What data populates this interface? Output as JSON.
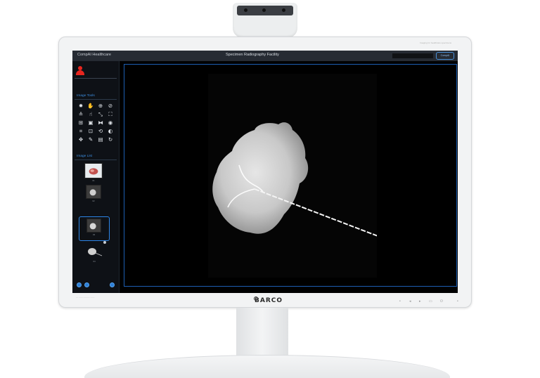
{
  "window": {
    "app_name": "CompAI Healthcare",
    "title": "Specimen Radiography Facility",
    "logo_text": "CompAI"
  },
  "monitor": {
    "brand": "BARCO",
    "top_right_label": "Imaging for healthcare specimens"
  },
  "sidebar": {
    "user_icon": "user-icon",
    "image_tools_title": "Image Tools",
    "image_tools": [
      {
        "name": "brightness-icon",
        "glyph": "✹"
      },
      {
        "name": "pan-hand-icon",
        "glyph": "✋"
      },
      {
        "name": "zoom-in-icon",
        "glyph": "⊕"
      },
      {
        "name": "reset-icon",
        "glyph": "⊘"
      },
      {
        "name": "level-adjust-icon",
        "glyph": "≗"
      },
      {
        "name": "hand-grab-icon",
        "glyph": "☝"
      },
      {
        "name": "measure-line-icon",
        "glyph": "⤡"
      },
      {
        "name": "fit-window-icon",
        "glyph": "⛶"
      },
      {
        "name": "zoom-box-icon",
        "glyph": "⊞"
      },
      {
        "name": "window-level-icon",
        "glyph": "▣"
      },
      {
        "name": "flip-horizontal-icon",
        "glyph": "⧓"
      },
      {
        "name": "eye-icon",
        "glyph": "◉"
      },
      {
        "name": "crop-icon",
        "glyph": "⌗"
      },
      {
        "name": "magnify-region-icon",
        "glyph": "⊡"
      },
      {
        "name": "rotate-icon",
        "glyph": "⟲"
      },
      {
        "name": "invert-icon",
        "glyph": "◐"
      },
      {
        "name": "move-icon",
        "glyph": "✥"
      },
      {
        "name": "annotate-icon",
        "glyph": "✎"
      },
      {
        "name": "save-icon",
        "glyph": "▤"
      },
      {
        "name": "refresh-icon",
        "glyph": "↻"
      }
    ],
    "image_list_title": "Image List",
    "images": [
      {
        "caption": "01"
      },
      {
        "caption": "02"
      },
      {
        "caption": "03"
      },
      {
        "caption": "04"
      }
    ],
    "selected_image_index": 2
  },
  "colors": {
    "accent": "#2e86e8",
    "user_icon": "#e8261f",
    "title_bar": "#262b33",
    "screen_background": "#000000"
  }
}
